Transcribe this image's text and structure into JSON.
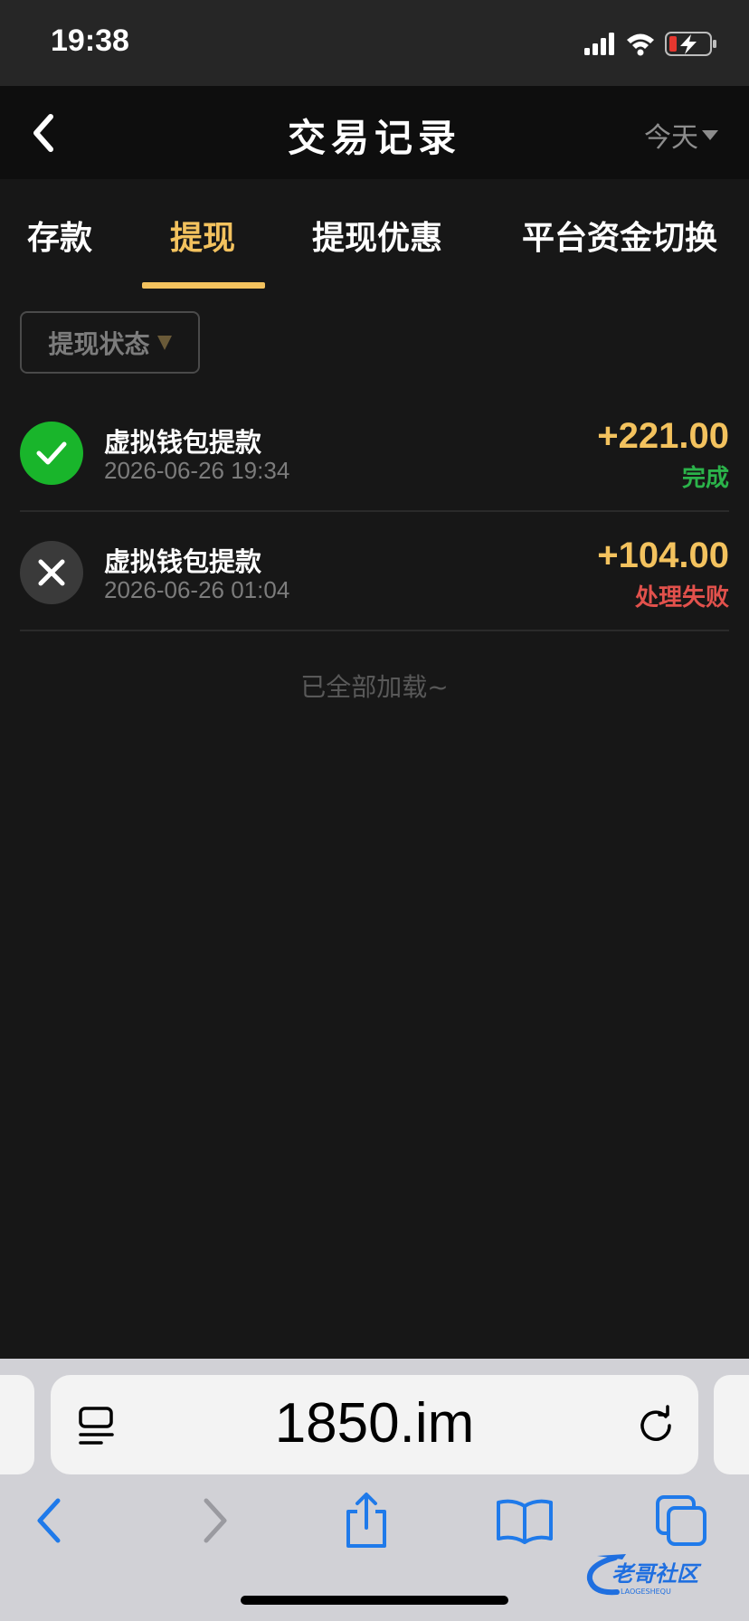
{
  "status_bar": {
    "time": "19:38"
  },
  "nav": {
    "title": "交易记录",
    "date_filter": "今天"
  },
  "tabs": [
    {
      "label": "存款",
      "active": false
    },
    {
      "label": "提现",
      "active": true
    },
    {
      "label": "提现优惠",
      "active": false
    },
    {
      "label": "平台资金切换",
      "active": false
    }
  ],
  "filter": {
    "label": "提现状态"
  },
  "records": [
    {
      "title": "虚拟钱包提款",
      "time": "2026-06-26 19:34",
      "amount": "+221.00",
      "status": "完成",
      "state": "success"
    },
    {
      "title": "虚拟钱包提款",
      "time": "2026-06-26 01:04",
      "amount": "+104.00",
      "status": "处理失败",
      "state": "failed"
    }
  ],
  "list_footer": "已全部加载~",
  "browser": {
    "url": "1850.im"
  },
  "watermark": {
    "text": "老哥社区",
    "subtext": "LAOGESHEQU"
  },
  "colors": {
    "accent": "#f3c25e",
    "success": "#19b52b",
    "failed": "#e2514c",
    "background": "#171717"
  }
}
